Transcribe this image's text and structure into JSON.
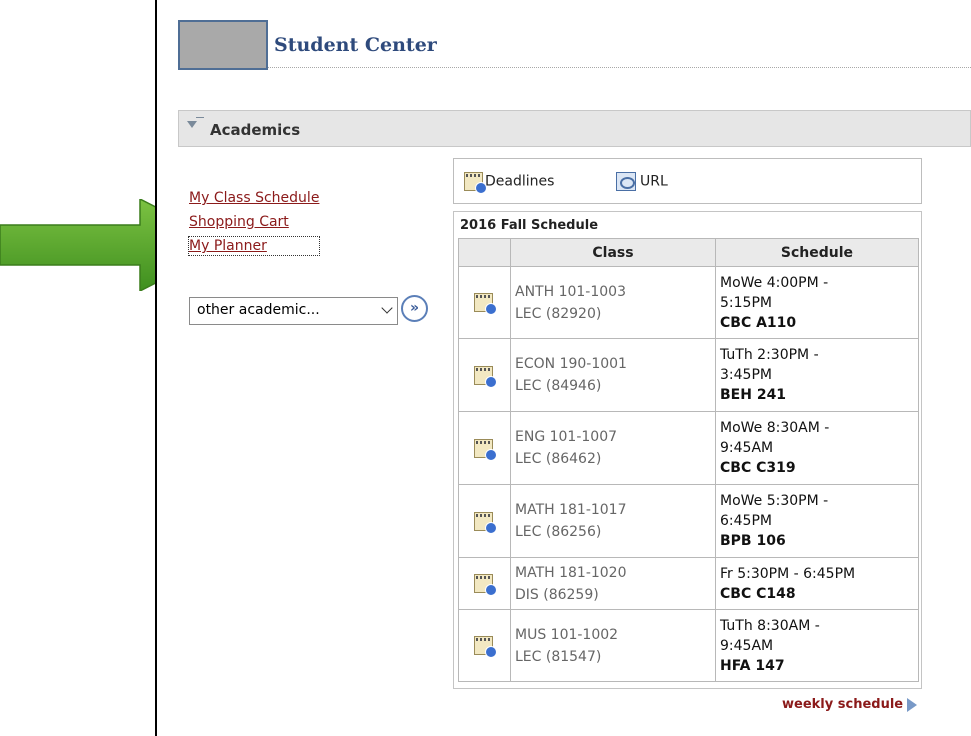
{
  "header": {
    "title": "Student Center"
  },
  "section": {
    "title": "Academics"
  },
  "links": [
    {
      "label": "My Class Schedule"
    },
    {
      "label": "Shopping Cart"
    },
    {
      "label": "My Planner"
    }
  ],
  "select": {
    "value": "other academic..."
  },
  "go_button": {
    "glyph": "»"
  },
  "toolbar": {
    "deadlines_label": "Deadlines",
    "url_label": "URL"
  },
  "schedule": {
    "title": "2016 Fall Schedule",
    "columns": [
      "",
      "Class",
      "Schedule"
    ],
    "rows": [
      {
        "class_line1": "ANTH 101-1003",
        "class_line2": "LEC (82920)",
        "sched_line1": "MoWe 4:00PM -",
        "sched_line2": "5:15PM",
        "sched_line3": "CBC A110"
      },
      {
        "class_line1": "ECON 190-1001",
        "class_line2": "LEC (84946)",
        "sched_line1": "TuTh 2:30PM -",
        "sched_line2": "3:45PM",
        "sched_line3": "BEH 241"
      },
      {
        "class_line1": "ENG 101-1007",
        "class_line2": "LEC (86462)",
        "sched_line1": "MoWe 8:30AM -",
        "sched_line2": "9:45AM",
        "sched_line3": "CBC C319"
      },
      {
        "class_line1": "MATH 181-1017",
        "class_line2": "LEC (86256)",
        "sched_line1": "MoWe 5:30PM -",
        "sched_line2": "6:45PM",
        "sched_line3": "BPB 106"
      },
      {
        "class_line1": "MATH 181-1020",
        "class_line2": "DIS (86259)",
        "sched_line1": "Fr 5:30PM - 6:45PM",
        "sched_line2": "",
        "sched_line3": "CBC C148"
      },
      {
        "class_line1": "MUS 101-1002",
        "class_line2": "LEC (81547)",
        "sched_line1": "TuTh 8:30AM -",
        "sched_line2": "9:45AM",
        "sched_line3": "HFA 147"
      }
    ],
    "weekly_link": "weekly schedule"
  },
  "colors": {
    "link": "#8b1a1a",
    "title": "#2e4a7c",
    "arrow": "#5aa32a"
  }
}
